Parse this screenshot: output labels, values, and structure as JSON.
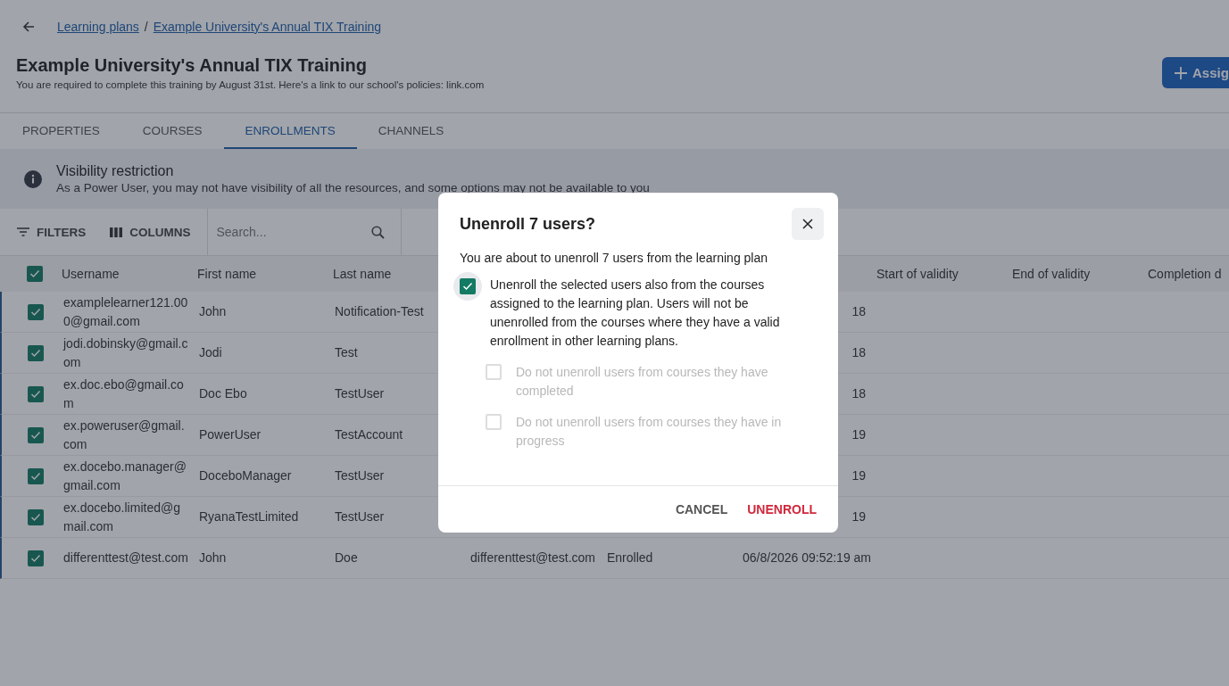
{
  "breadcrumb": {
    "links": [
      "Learning plans",
      "Example University's Annual TIX Training"
    ],
    "separator": "/"
  },
  "header": {
    "title": "Example University's Annual TIX Training",
    "description": "You are required to complete this training by August 31st.  Here's a link to our school's policies: link.com",
    "assign_button": "Assig"
  },
  "tabs": [
    {
      "label": "PROPERTIES",
      "selected": false
    },
    {
      "label": "COURSES",
      "selected": false
    },
    {
      "label": "ENROLLMENTS",
      "selected": true
    },
    {
      "label": "CHANNELS",
      "selected": false
    }
  ],
  "notice": {
    "title": "Visibility restriction",
    "text": "As a Power User, you may not have visibility of all the resources, and some options may not be available to you"
  },
  "toolbar": {
    "filters": "FILTERS",
    "columns": "COLUMNS",
    "search": {
      "placeholder": "Search..."
    }
  },
  "table": {
    "all_checked": true,
    "columns": [
      "Username",
      "First name",
      "Last name",
      "Start of validity",
      "End of validity",
      "Completion d"
    ],
    "rows": [
      {
        "checked": true,
        "username": "examplelearner121.000@gmail.com",
        "first_name": "John",
        "last_name": "Notification-Test",
        "column_6": "18"
      },
      {
        "checked": true,
        "username": "jodi.dobinsky@gmail.com",
        "first_name": "Jodi",
        "last_name": "Test",
        "column_6": "18"
      },
      {
        "checked": true,
        "username": "ex.doc.ebo@gmail.com",
        "first_name": "Doc Ebo",
        "last_name": "TestUser",
        "column_6": "18"
      },
      {
        "checked": true,
        "username": "ex.poweruser@gmail.com",
        "first_name": "PowerUser",
        "last_name": "TestAccount",
        "column_6": "19"
      },
      {
        "checked": true,
        "username": "ex.docebo.manager@gmail.com",
        "first_name": "DoceboManager",
        "last_name": "TestUser",
        "column_6": "19"
      },
      {
        "checked": true,
        "username": "ex.docebo.limited@gmail.com",
        "first_name": "RyanaTestLimited",
        "last_name": "TestUser",
        "column_6": "19"
      },
      {
        "checked": true,
        "username": "differenttest@test.com",
        "first_name": "John",
        "last_name": "Doe",
        "column_4": "differenttest@test.com",
        "column_5": "Enrolled",
        "column_6": "06/8/2026 09:52:19 am"
      }
    ]
  },
  "dialog": {
    "title": "Unenroll 7 users?",
    "message": "You are about to unenroll 7 users from the learning plan",
    "options": [
      {
        "kind": "main",
        "label": "Unenroll the selected users also from the courses assigned to the learning plan. Users will not be unenrolled from the courses where they have a valid enrollment in other learning plans.",
        "checked": true,
        "disabled": false
      },
      {
        "kind": "sub",
        "label": "Do not unenroll users from courses they have completed",
        "checked": false,
        "disabled": true
      },
      {
        "kind": "sub",
        "label": "Do not unenroll users from courses they have in progress",
        "checked": false,
        "disabled": true
      }
    ],
    "buttons": [
      {
        "kind": "cancel",
        "label": "CANCEL"
      },
      {
        "kind": "danger",
        "label": "UNENROLL"
      }
    ]
  }
}
